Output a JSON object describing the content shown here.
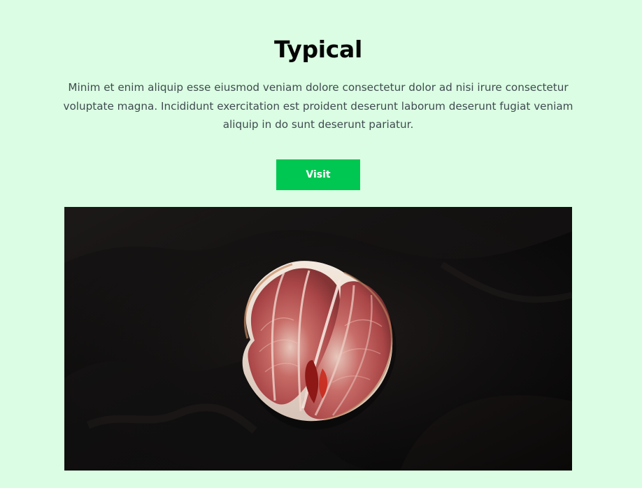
{
  "hero": {
    "title": "Typical",
    "description": "Minim et enim aliquip esse eiusmod veniam dolore consectetur dolor ad nisi irure consectetur voluptate magna. Incididunt exercitation est proident deserunt laborum deserunt fugiat veniam aliquip in do sunt deserunt pariatur.",
    "button_label": "Visit",
    "image_subject": "blood-orange-half-on-dark-fabric"
  },
  "colors": {
    "page_background": "#dbfde3",
    "title": "#050505",
    "description": "#3f4b50",
    "button_background": "#00c751",
    "button_text": "#ffffff",
    "image_background": "#0d0b0b",
    "fruit_flesh": "#b84a4a",
    "fruit_peel": "#e7ded6"
  }
}
